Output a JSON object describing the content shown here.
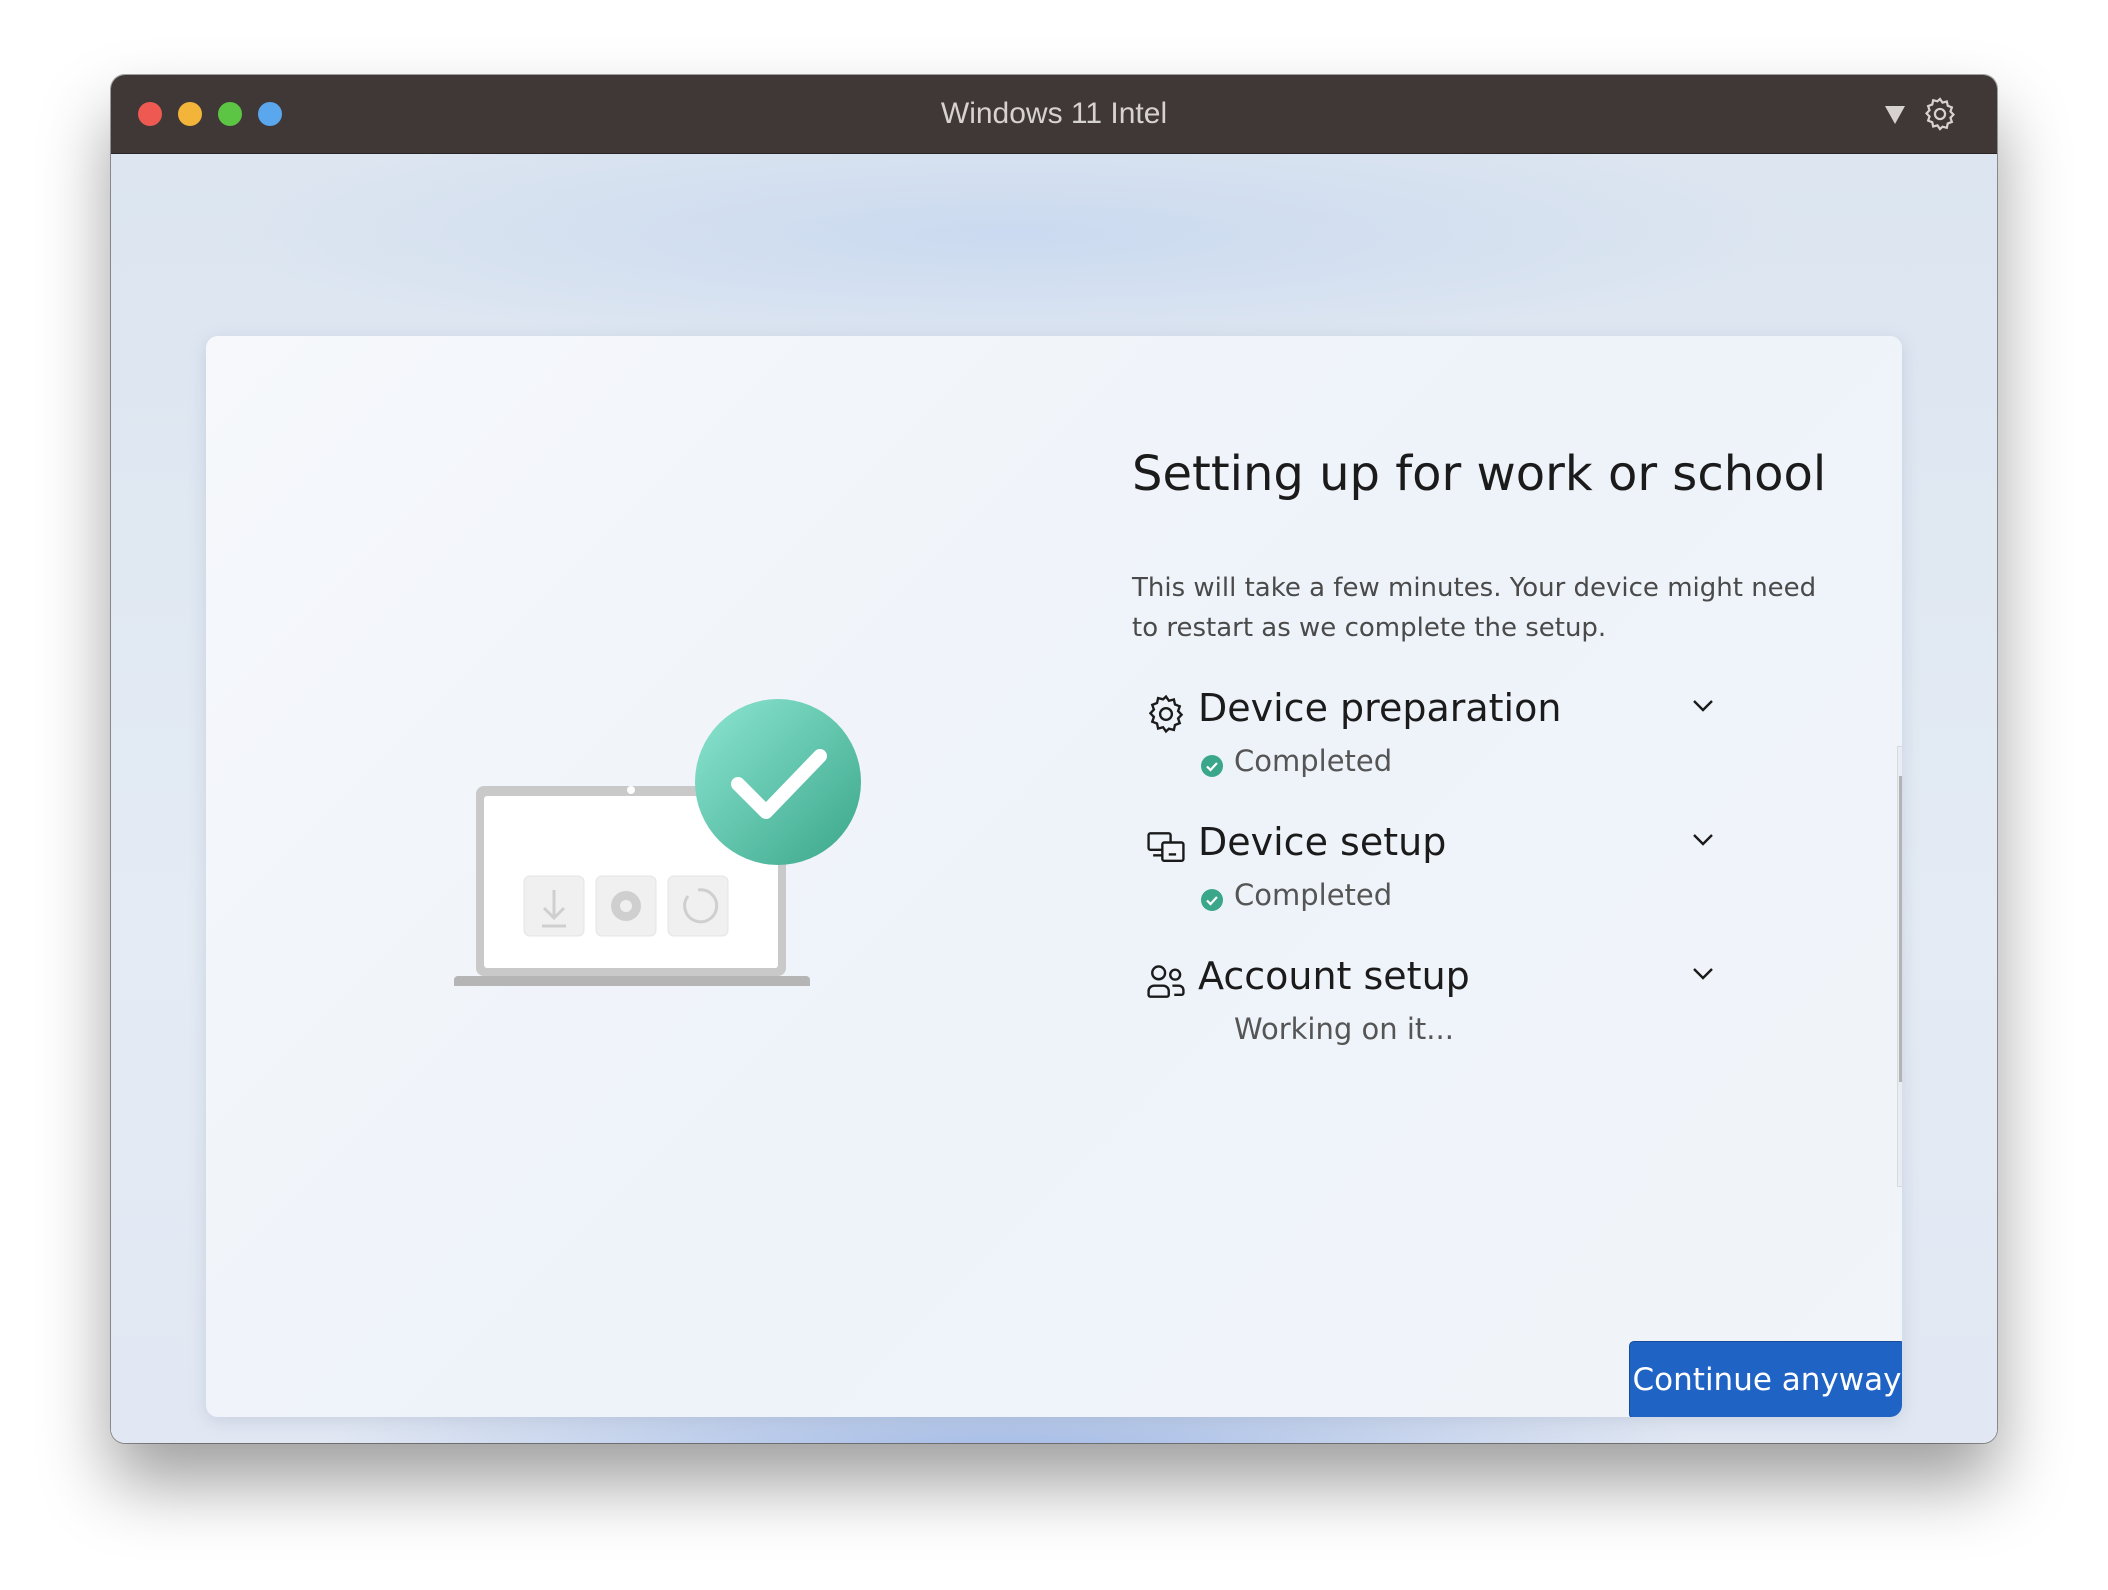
{
  "window": {
    "title": "Windows 11 Intel"
  },
  "colors": {
    "accent": "#1f63c5",
    "success": "#3aa68a",
    "titlebar": "#3f3837"
  },
  "setup": {
    "heading": "Setting up for work or school",
    "description": "This will take a few minutes. Your device might need to restart as we complete the setup.",
    "steps": [
      {
        "title": "Device preparation",
        "status": "Completed",
        "icon": "gear-icon",
        "state": "completed"
      },
      {
        "title": "Device setup",
        "status": "Completed",
        "icon": "device-setup-icon",
        "state": "completed"
      },
      {
        "title": "Account setup",
        "status": "Working on it...",
        "icon": "people-icon",
        "state": "in-progress"
      }
    ],
    "continue_label": "Continue anyway"
  },
  "footer": {
    "icons": [
      "accessibility-icon",
      "volume-icon"
    ]
  }
}
